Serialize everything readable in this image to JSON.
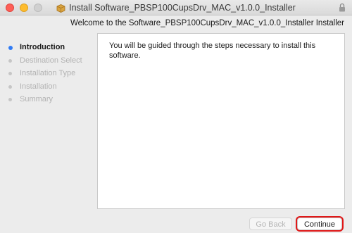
{
  "window": {
    "title": "Install Software_PBSP100CupsDrv_MAC_v1.0.0_Installer",
    "title_icon": "package-installer-icon"
  },
  "header": {
    "welcome": "Welcome to the Software_PBSP100CupsDrv_MAC_v1.0.0_Installer Installer"
  },
  "sidebar": {
    "steps": [
      {
        "label": "Introduction",
        "state": "active"
      },
      {
        "label": "Destination Select",
        "state": "pending"
      },
      {
        "label": "Installation Type",
        "state": "pending"
      },
      {
        "label": "Installation",
        "state": "pending"
      },
      {
        "label": "Summary",
        "state": "pending"
      }
    ]
  },
  "main": {
    "body_text": "You will be guided through the steps necessary to install this software."
  },
  "buttons": {
    "back_label": "Go Back",
    "continue_label": "Continue"
  },
  "colors": {
    "active_step_dot": "#2f7bf5",
    "highlight_outline": "#e01818"
  }
}
